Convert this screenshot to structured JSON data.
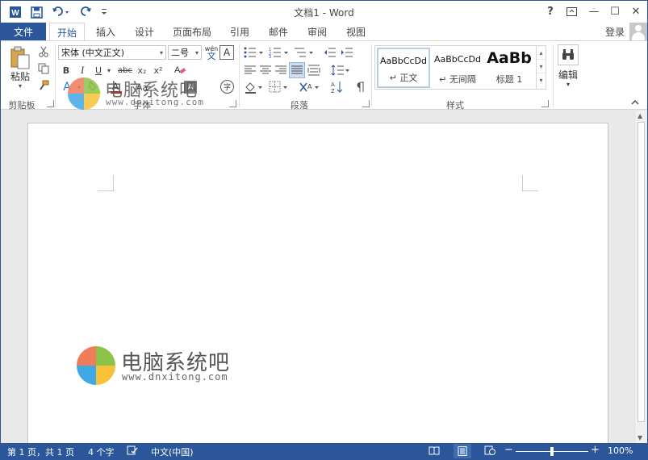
{
  "app": {
    "document_title": "文档1 - Word"
  },
  "quick_access": {
    "word_icon_letter": "W",
    "save": "save-icon",
    "undo": "undo-icon",
    "redo": "redo-icon",
    "customize": "customize-icon"
  },
  "window_controls": {
    "help": "?",
    "ribbon_display": "ribbon-display-icon",
    "minimize": "—",
    "maximize": "☐",
    "close": "✕"
  },
  "tabs": {
    "file": "文件",
    "items": [
      "开始",
      "插入",
      "设计",
      "页面布局",
      "引用",
      "邮件",
      "审阅",
      "视图"
    ],
    "active": "开始",
    "login": "登录"
  },
  "ribbon": {
    "clipboard": {
      "paste_label": "粘贴",
      "group_label": "剪贴板"
    },
    "font": {
      "font_name": "宋体 (中文正文)",
      "font_size": "二号",
      "pinyin_label": "wén\n文",
      "bold": "B",
      "italic": "I",
      "underline": "U",
      "strike": "abc",
      "subscript": "x₂",
      "superscript": "x²",
      "group_label": "字体",
      "char_shade": "A",
      "enclose": "字"
    },
    "paragraph": {
      "group_label": "段落"
    },
    "styles": {
      "items": [
        {
          "sample": "AaBbCcDd",
          "name": "↵ 正文"
        },
        {
          "sample": "AaBbCcDd",
          "name": "↵ 无间隔"
        },
        {
          "sample": "AaBb",
          "name": "标题 1"
        }
      ],
      "group_label": "样式"
    },
    "editing": {
      "label": "编辑"
    }
  },
  "watermark": {
    "cn": "电脑系统吧",
    "en": "www.dnxitong.com"
  },
  "status": {
    "page": "第 1 页，共 1 页",
    "words": "4 个字",
    "language": "中文(中国)",
    "zoom": "100%",
    "zoom_minus": "−",
    "zoom_plus": "+",
    "zoom_level": 0.5
  },
  "colors": {
    "accent": "#2b579a"
  }
}
